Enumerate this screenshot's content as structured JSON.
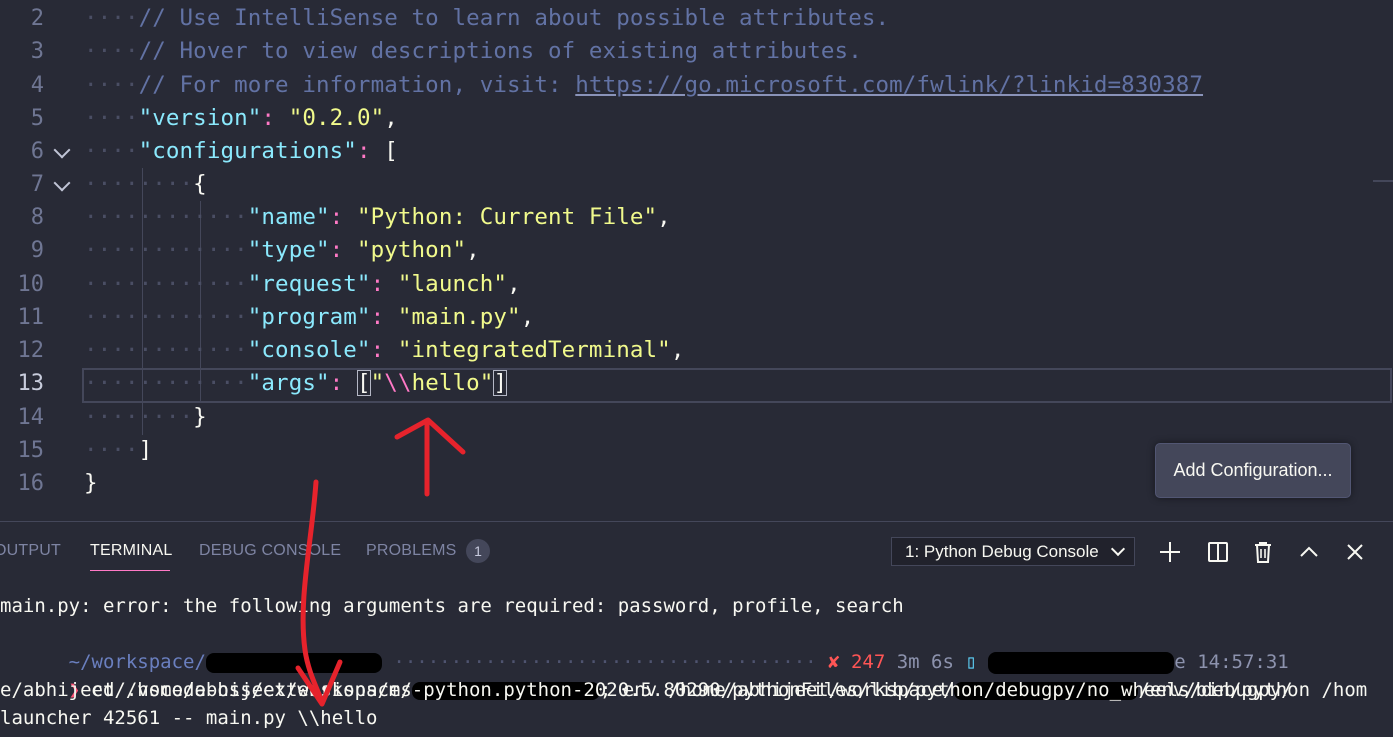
{
  "editor": {
    "lines": [
      {
        "num": "2",
        "indent": "····",
        "comment": "// Use IntelliSense to learn about possible attributes."
      },
      {
        "num": "3",
        "indent": "····",
        "comment": "// Hover to view descriptions of existing attributes."
      },
      {
        "num": "4",
        "indent": "····",
        "comment": "// For more information, visit: ",
        "link": "https://go.microsoft.com/fwlink/?linkid=830387"
      },
      {
        "num": "5",
        "indent": "····",
        "key": "\"version\"",
        "colon": ": ",
        "value": "\"0.2.0\"",
        "tail": ","
      },
      {
        "num": "6",
        "indent": "····",
        "key": "\"configurations\"",
        "colon": ": ",
        "tail": "["
      },
      {
        "num": "7",
        "indent": "········",
        "tail": "{"
      },
      {
        "num": "8",
        "indent": "············",
        "key": "\"name\"",
        "colon": ": ",
        "value": "\"Python: Current File\"",
        "tail": ","
      },
      {
        "num": "9",
        "indent": "············",
        "key": "\"type\"",
        "colon": ": ",
        "value": "\"python\"",
        "tail": ","
      },
      {
        "num": "10",
        "indent": "············",
        "key": "\"request\"",
        "colon": ": ",
        "value": "\"launch\"",
        "tail": ","
      },
      {
        "num": "11",
        "indent": "············",
        "key": "\"program\"",
        "colon": ": ",
        "value": "\"main.py\"",
        "tail": ","
      },
      {
        "num": "12",
        "indent": "············",
        "key": "\"console\"",
        "colon": ": ",
        "value": "\"integratedTerminal\"",
        "tail": ","
      },
      {
        "num": "13",
        "indent": "············",
        "key": "\"args\"",
        "colon": ": ",
        "open": "[",
        "q1": "\"",
        "escape": "\\\\",
        "word": "hello",
        "q2": "\"",
        "close": "]"
      },
      {
        "num": "14",
        "indent": "········",
        "tail": "}"
      },
      {
        "num": "15",
        "indent": "····",
        "tail": "]"
      },
      {
        "num": "16",
        "indent": "",
        "tail": "}"
      }
    ],
    "add_configuration_label": "Add Configuration..."
  },
  "panel": {
    "tabs": {
      "output": "OUTPUT",
      "terminal": "TERMINAL",
      "debug_console": "DEBUG CONSOLE",
      "problems": "PROBLEMS",
      "problems_count": "1"
    },
    "terminal_select": "1: Python Debug Console"
  },
  "terminal": {
    "line1": "main.py: error: the following arguments are required: password, profile, search",
    "line2_path": "~/workspace/",
    "line2_dots": "·····································",
    "line2_status": "✘ 247",
    "line2_duration": "3m 6s",
    "line2_sep": "▯",
    "line2_e": "e",
    "line2_time": "14:57:31",
    "line3_prompt": "❯",
    "line3_cmd_a": " cd /home/abhijeet/workspace/",
    "line3_cmd_b": "; env /home/abhijeet/workspace/",
    "line3_cmd_c": "/env/bin/python /hom",
    "line4": "e/abhijeet/.vscode-oss/extensions/ms-python.python-2020.5.80290/pythonFiles/lib/python/debugpy/no_wheels/debugpy/",
    "line5": "launcher 42561 -- main.py \\\\hello"
  },
  "colors": {
    "background": "#282a36",
    "comment": "#6272a4",
    "key": "#8be9fd",
    "string": "#f1fa8c",
    "punctuation": "#ff79c6",
    "annotation": "#e6232c"
  }
}
